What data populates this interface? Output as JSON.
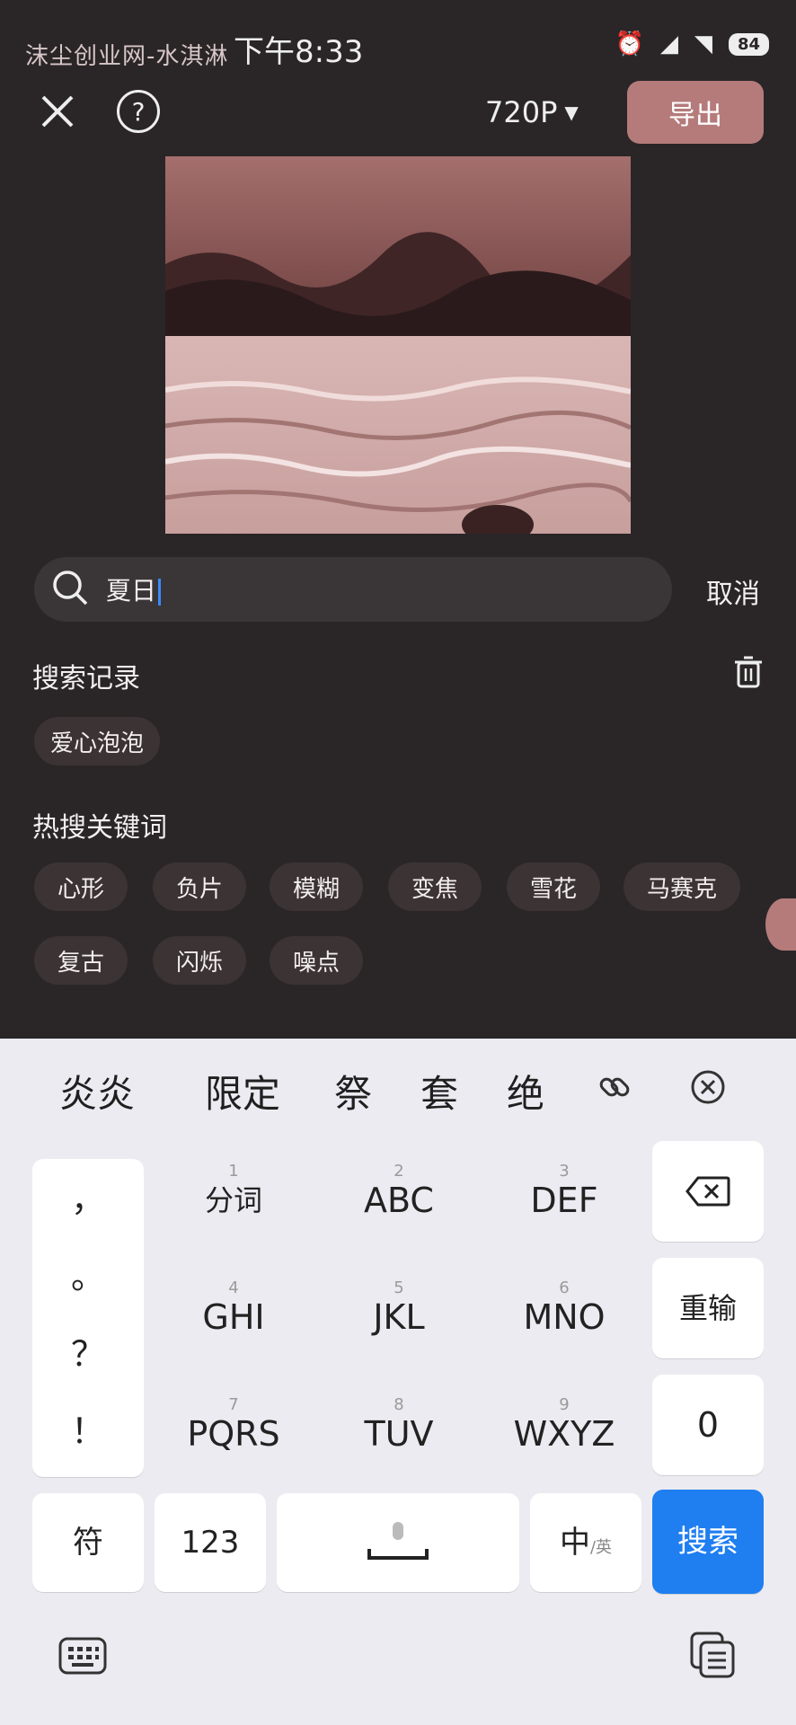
{
  "status_bar": {
    "watermark": "沫尘创业网-水淇淋",
    "time": "下午8:33",
    "battery": "84"
  },
  "top_bar": {
    "resolution": "720P",
    "export_label": "导出"
  },
  "search": {
    "query": "夏日",
    "cancel_label": "取消"
  },
  "history": {
    "title": "搜索记录",
    "items": [
      "爱心泡泡"
    ]
  },
  "hot": {
    "title": "热搜关键词",
    "items": [
      "心形",
      "负片",
      "模糊",
      "变焦",
      "雪花",
      "马赛克",
      "复古",
      "闪烁",
      "噪点"
    ]
  },
  "keyboard": {
    "candidates": [
      "炎炎",
      "限定",
      "祭",
      "套",
      "绝"
    ],
    "punct": [
      "，",
      "。",
      "？",
      "！"
    ],
    "keys": [
      {
        "num": "1",
        "label": "分词"
      },
      {
        "num": "2",
        "label": "ABC"
      },
      {
        "num": "3",
        "label": "DEF"
      },
      {
        "num": "4",
        "label": "GHI"
      },
      {
        "num": "5",
        "label": "JKL"
      },
      {
        "num": "6",
        "label": "MNO"
      },
      {
        "num": "7",
        "label": "PQRS"
      },
      {
        "num": "8",
        "label": "TUV"
      },
      {
        "num": "9",
        "label": "WXYZ"
      }
    ],
    "reenter_label": "重输",
    "zero_label": "0",
    "symbol_label": "符",
    "num_label": "123",
    "lang_label": "中",
    "lang_sub": "/英",
    "search_label": "搜索"
  },
  "colors": {
    "background": "#2a2627",
    "accent": "#b57b7b",
    "search_key": "#1f7ef0"
  }
}
